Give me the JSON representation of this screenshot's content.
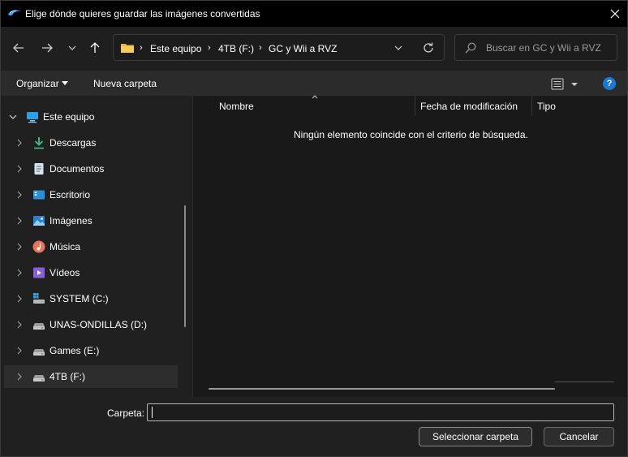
{
  "window": {
    "title": "Elige dónde quieres guardar las imágenes convertidas"
  },
  "icons": {
    "app": "dolphin-icon",
    "close": "close-icon",
    "back": "arrow-left-icon",
    "forward": "arrow-right-icon",
    "recent": "chevron-down-icon",
    "up": "arrow-up-icon",
    "refresh": "refresh-icon",
    "search": "search-icon",
    "view": "list-view-icon",
    "help": "help-icon"
  },
  "colors": {
    "accent": "#1a78d4",
    "folder": "#e8b64a",
    "background": "#191919"
  },
  "address_bar": {
    "crumbs": [
      "Este equipo",
      "4TB (F:)",
      "GC y Wii a RVZ"
    ]
  },
  "search": {
    "placeholder": "Buscar en GC y Wii a RVZ"
  },
  "command_bar": {
    "organize_label": "Organizar",
    "new_folder_label": "Nueva carpeta",
    "help_label": "?"
  },
  "nav_tree": {
    "root": "Este equipo",
    "items": [
      {
        "label": "Descargas",
        "icon": "download-icon"
      },
      {
        "label": "Documentos",
        "icon": "documents-icon"
      },
      {
        "label": "Escritorio",
        "icon": "desktop-icon"
      },
      {
        "label": "Imágenes",
        "icon": "pictures-icon"
      },
      {
        "label": "Música",
        "icon": "music-icon"
      },
      {
        "label": "Vídeos",
        "icon": "videos-icon"
      },
      {
        "label": "SYSTEM (C:)",
        "icon": "system-drive-icon"
      },
      {
        "label": "UNAS-ONDILLAS (D:)",
        "icon": "drive-icon"
      },
      {
        "label": "Games (E:)",
        "icon": "drive-icon"
      },
      {
        "label": "4TB (F:)",
        "icon": "drive-icon",
        "selected": true
      }
    ]
  },
  "file_list": {
    "columns": [
      "Nombre",
      "Fecha de modificación",
      "Tipo"
    ],
    "empty_message": "Ningún elemento coincide con el criterio de búsqueda."
  },
  "footer": {
    "folder_label": "Carpeta:",
    "folder_value": "",
    "select_button": "Seleccionar carpeta",
    "cancel_button": "Cancelar"
  }
}
